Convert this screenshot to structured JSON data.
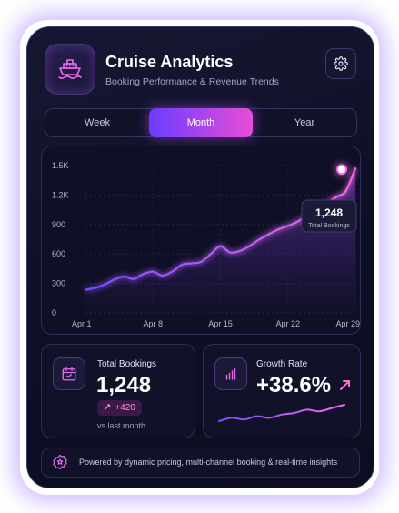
{
  "header": {
    "title": "Cruise Analytics",
    "subtitle": "Booking Performance & Revenue Trends",
    "app_icon": "cruise-ship-icon",
    "settings_icon": "gear-icon"
  },
  "tabs": [
    {
      "label": "Week",
      "active": false
    },
    {
      "label": "Month",
      "active": true
    },
    {
      "label": "Year",
      "active": false
    }
  ],
  "chart_data": {
    "type": "area",
    "x": [
      "Apr 1",
      "Apr 2",
      "Apr 3",
      "Apr 4",
      "Apr 5",
      "Apr 6",
      "Apr 7",
      "Apr 8",
      "Apr 9",
      "Apr 10",
      "Apr 11",
      "Apr 12",
      "Apr 13",
      "Apr 14",
      "Apr 15",
      "Apr 16",
      "Apr 17",
      "Apr 18",
      "Apr 19",
      "Apr 20",
      "Apr 21",
      "Apr 22",
      "Apr 23",
      "Apr 24",
      "Apr 25",
      "Apr 26",
      "Apr 27",
      "Apr 28",
      "Apr 29"
    ],
    "xticks": [
      "Apr 1",
      "Apr 8",
      "Apr 15",
      "Apr 22",
      "Apr 29"
    ],
    "values": [
      235,
      255,
      290,
      340,
      370,
      345,
      395,
      420,
      380,
      420,
      490,
      505,
      520,
      600,
      680,
      615,
      630,
      680,
      745,
      800,
      850,
      885,
      930,
      990,
      1070,
      1110,
      1180,
      1240,
      1470
    ],
    "yticks": [
      "0",
      "300",
      "600",
      "900",
      "1.2K",
      "1.5K"
    ],
    "ylim": [
      0,
      1500
    ],
    "grid": true,
    "tooltip": {
      "value": "1,248",
      "label": "Total Bookings"
    },
    "colors": {
      "start": "#7b4dff",
      "end": "#f06ae8"
    }
  },
  "stats": {
    "bookings": {
      "icon": "calendar-check-icon",
      "label": "Total Bookings",
      "value": "1,248",
      "delta": "+420",
      "delta_icon": "arrow-up-right-icon",
      "note": "vs last month"
    },
    "growth": {
      "icon": "bar-chart-icon",
      "label": "Growth Rate",
      "value": "+38.6%",
      "trend_icon": "arrow-up-right-icon",
      "sparkline": [
        3,
        5,
        4,
        6,
        5,
        7,
        8,
        10,
        9,
        11,
        13
      ]
    }
  },
  "footer": {
    "icon": "star-badge-icon",
    "text": "Powered by dynamic pricing, multi-channel booking & real-time insights"
  }
}
